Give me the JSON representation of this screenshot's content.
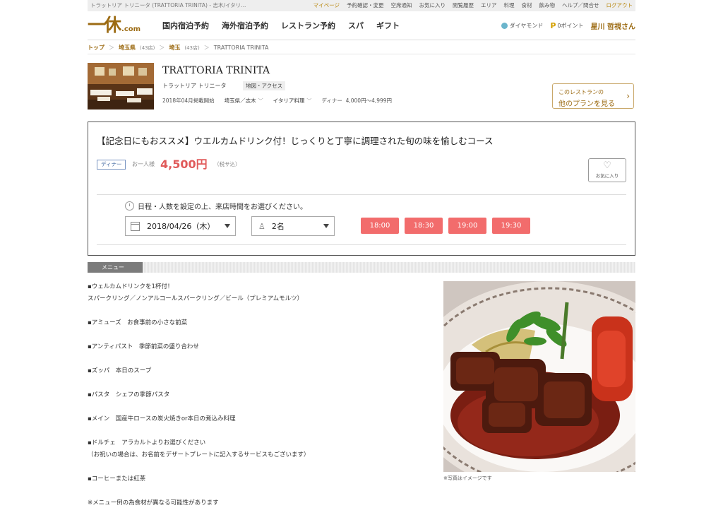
{
  "topbar": {
    "site_title": "トラットリア トリニータ (TRATTORIA TRINITA) - 志木/イタリ...",
    "links": [
      "マイページ",
      "予約確認・変更",
      "空席通知",
      "お気に入り",
      "閲覧履歴",
      "エリア",
      "料理",
      "食材",
      "飲み物",
      "ヘルプ／問合せ",
      "ログアウト"
    ]
  },
  "header": {
    "logo_kanji": "一休",
    "logo_suffix": ".com",
    "nav": [
      "国内宿泊予約",
      "海外宿泊予約",
      "レストラン予約",
      "スパ",
      "ギフト"
    ],
    "diamond_label": "ダイヤモンド",
    "points_icon": "P",
    "points_label": "0ポイント",
    "user_name": "星川 哲視さん"
  },
  "breadcrumb": {
    "top": "トップ",
    "pref": "埼玉県",
    "pref_count": "(43店)",
    "area": "埼玉",
    "area_count": "(43店)",
    "current": "TRATTORIA TRINITA",
    "sep": "＞"
  },
  "restaurant": {
    "name": "TRATTORIA TRINITA",
    "kana": "トラットリア トリニータ",
    "map_link": "地図・アクセス",
    "listed_since": "2018年04月掲載開始",
    "location": "埼玉県／志木",
    "cuisine": "イタリア料理",
    "dinner_label": "ディナー",
    "price_range": "4,000円〜4,999円",
    "other_plans_line1": "このレストランの",
    "other_plans_line2": "他のプランを見る"
  },
  "plan": {
    "title": "【記念日にもおススメ】ウエルカムドリンク付！じっくりと丁寧に調理された旬の味を愉しむコース",
    "badge": "ディナー",
    "price_label": "お一人様",
    "price": "4,500円",
    "tax": "（税サ込）",
    "favorite_label": "お気に入り",
    "instruction": "日程・人数を設定の上、来店時間をお選びください。",
    "date": "2018/04/26（木）",
    "people": "2名",
    "times": [
      "18:00",
      "18:30",
      "19:00",
      "19:30"
    ],
    "accent_color": "#f26c6c"
  },
  "menu": {
    "tab_label": "メニュー",
    "lines": [
      "▪ウェルカムドリンクを1杯付！",
      "スパークリング／ノンアルコールスパークリング／ビール（プレミアムモルツ）",
      "",
      "▪アミューズ　お食事前の小さな前菜",
      "",
      "▪アンティパスト　季節前菜の盛り合わせ",
      "",
      "▪ズッパ　本日のスープ",
      "",
      "▪パスタ　シェフの季節パスタ",
      "",
      "▪メイン　国産牛ロースの炭火焼きor本日の煮込み料理",
      "",
      "▪ドルチェ　アラカルトよりお選びください",
      "（お祝いの場合は、お名前をデザートプレートに記入するサービスもございます）",
      "",
      "▪コーヒーまたは紅茶",
      "",
      "※メニュー例の為食材が異なる可能性があります"
    ],
    "photo_caption": "※写真はイメージです"
  }
}
